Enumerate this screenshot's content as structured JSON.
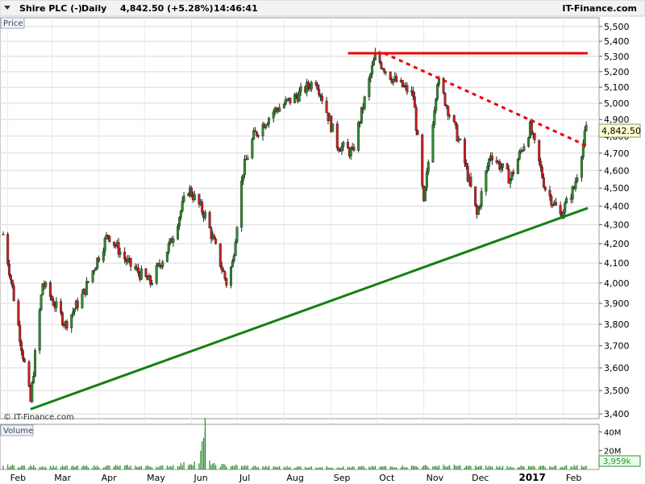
{
  "header": {
    "instrument": "Shire PLC (-)",
    "period": "Daily",
    "last": "4,842.50 (+5.28%)",
    "time": "14:46:41",
    "brand": "IT-Finance.com"
  },
  "panels": {
    "price": "Price",
    "volume": "Volume"
  },
  "watermark": "© IT-Finance.com",
  "colors": {
    "up": "#2e8b2e",
    "down": "#cc1f1f",
    "support": "#138013",
    "resistance": "#ee0000",
    "grid": "#d9d9d9",
    "price_tag": "#ffffcc"
  },
  "chart_data": {
    "type": "candlestick",
    "yaxis": {
      "ticks": [
        "5,500",
        "5,400",
        "5,300",
        "5,200",
        "5,100",
        "5,000",
        "4,900",
        "4,800",
        "4,700",
        "4,600",
        "4,500",
        "4,400",
        "4,300",
        "4,200",
        "4,100",
        "4,000",
        "3,900",
        "3,800",
        "3,700",
        "3,600",
        "3,500",
        "3,400"
      ],
      "tick_values": [
        5500,
        5400,
        5300,
        5200,
        5100,
        5000,
        4900,
        4800,
        4700,
        4600,
        4500,
        4400,
        4300,
        4200,
        4100,
        4000,
        3900,
        3800,
        3700,
        3600,
        3500,
        3400
      ],
      "scale": "log",
      "range": [
        3380,
        5560
      ]
    },
    "xaxis": {
      "labels": [
        "Feb",
        "Mar",
        "Apr",
        "May",
        "Jun",
        "Jul",
        "Aug",
        "Sep",
        "Oct",
        "Nov",
        "Dec",
        "2017",
        "Feb"
      ],
      "label_dates": [
        "2016-02",
        "2016-03",
        "2016-04",
        "2016-05",
        "2016-06",
        "2016-07",
        "2016-08",
        "2016-09",
        "2016-10",
        "2016-11",
        "2016-12",
        "2017-01",
        "2017-02"
      ],
      "range": [
        "2016-01-29",
        "2017-02-17"
      ]
    },
    "volume_axis": {
      "ticks": [
        "40M",
        "20M"
      ],
      "tick_values": [
        40,
        20
      ],
      "range": [
        0,
        48
      ]
    },
    "last_price_label": "4,842.50",
    "last_volume_label": "3,959k",
    "series": [
      {
        "name": "price",
        "type": "line",
        "x": [
          "2016-01-29",
          "2016-02-10",
          "2016-02-16",
          "2016-02-24",
          "2016-03-10",
          "2016-03-22",
          "2016-04-07",
          "2016-04-20",
          "2016-05-05",
          "2016-05-18",
          "2016-05-30",
          "2016-06-10",
          "2016-06-24",
          "2016-06-28",
          "2016-07-05",
          "2016-07-12",
          "2016-07-25",
          "2016-08-10",
          "2016-08-22",
          "2016-09-05",
          "2016-09-15",
          "2016-09-30",
          "2016-10-12",
          "2016-10-25",
          "2016-11-01",
          "2016-11-10",
          "2016-11-25",
          "2016-12-06",
          "2016-12-15",
          "2016-12-28",
          "2017-01-10",
          "2017-01-20",
          "2017-01-30",
          "2017-02-08",
          "2017-02-16"
        ],
        "y": [
          4250,
          3700,
          3450,
          4000,
          3800,
          3950,
          4250,
          4100,
          4000,
          4200,
          4500,
          4350,
          4000,
          4100,
          4600,
          4800,
          4950,
          5050,
          5150,
          4750,
          4700,
          5300,
          5150,
          5050,
          4400,
          5150,
          4750,
          4350,
          4700,
          4550,
          4850,
          4500,
          4350,
          4500,
          4842.5
        ]
      },
      {
        "name": "support",
        "type": "trendline",
        "x": [
          "2016-02-16",
          "2017-02-17"
        ],
        "y": [
          3420,
          4390
        ]
      },
      {
        "name": "resistance",
        "type": "trendline",
        "x": [
          "2016-09-12",
          "2017-02-17"
        ],
        "y": [
          5320,
          5320
        ]
      },
      {
        "name": "down-trendline",
        "type": "trendline",
        "x": [
          "2016-10-06",
          "2017-02-17"
        ],
        "y": [
          5320,
          4740
        ]
      }
    ],
    "volume": {
      "x": [
        "2016-01-29",
        "2016-02-15",
        "2016-03-15",
        "2016-04-15",
        "2016-05-15",
        "2016-06-06",
        "2016-06-10",
        "2016-06-14",
        "2016-07-15",
        "2016-08-15",
        "2016-09-15",
        "2016-10-15",
        "2016-11-15",
        "2016-12-15",
        "2017-01-15",
        "2017-02-16"
      ],
      "values": [
        4,
        3.5,
        3.2,
        3.6,
        3.3,
        8,
        40,
        5,
        3,
        2.8,
        2.6,
        3.3,
        3.8,
        3.2,
        3,
        3.96
      ]
    }
  }
}
